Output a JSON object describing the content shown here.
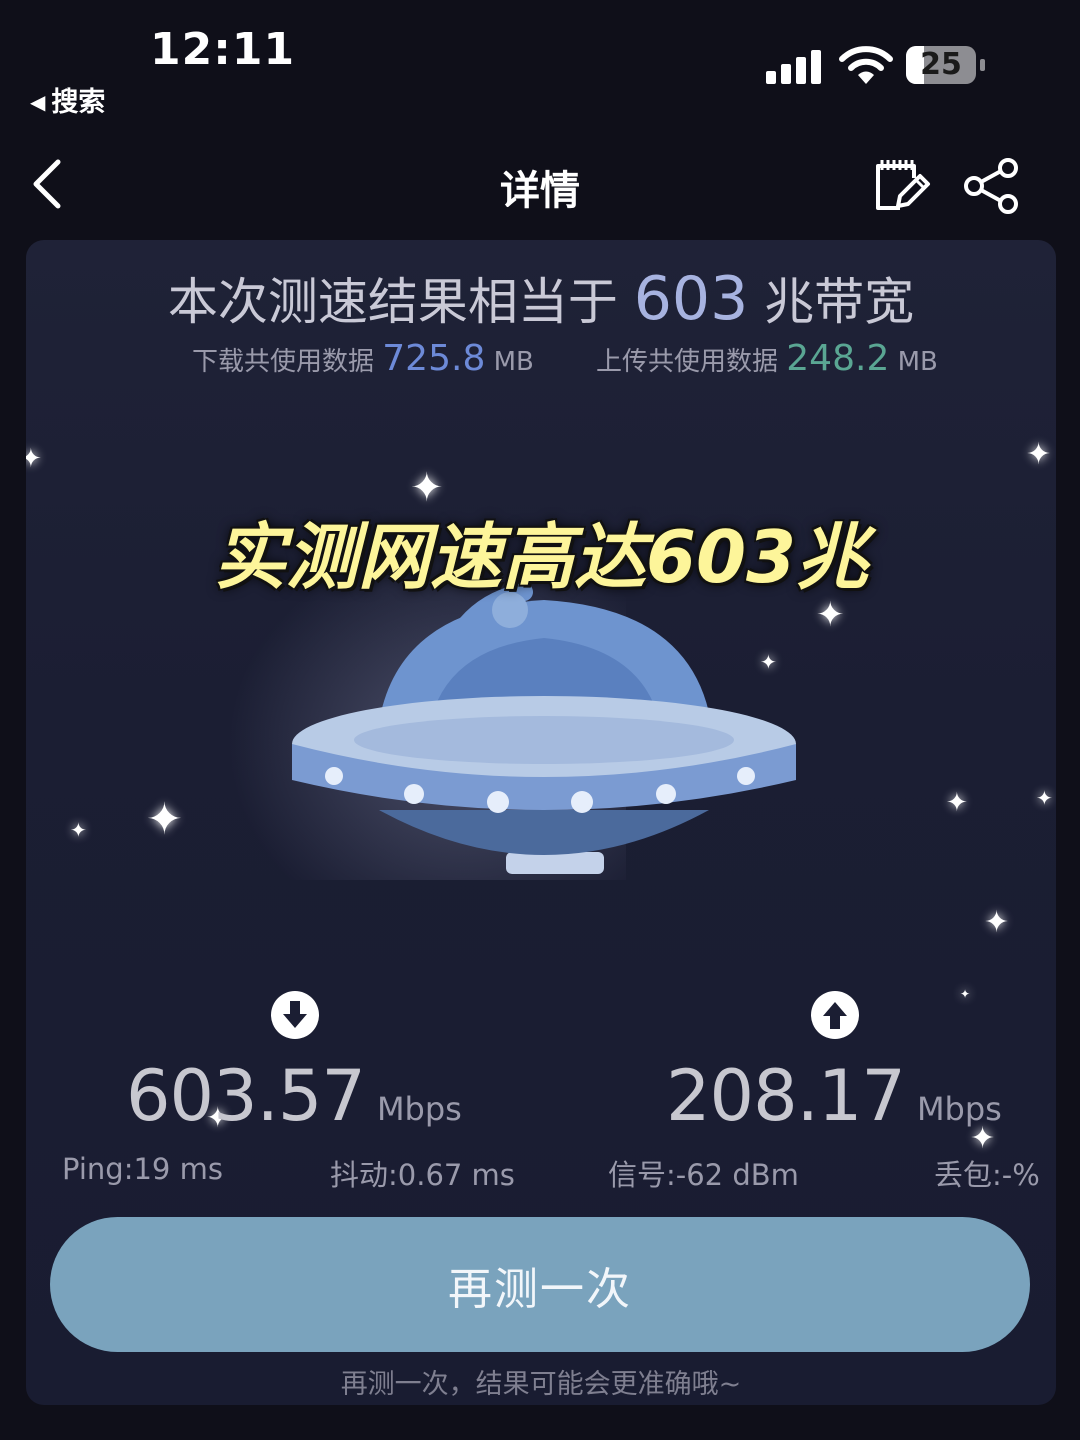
{
  "status_bar": {
    "time": "12:11",
    "back_app_label": "搜索",
    "battery_level": "25"
  },
  "nav": {
    "title": "详情",
    "icons": {
      "back": "chevron-left-icon",
      "edit": "edit-note-icon",
      "share": "share-icon"
    }
  },
  "result": {
    "summary_prefix": "本次测速结果相当于",
    "bandwidth": "603",
    "summary_suffix": "兆带宽",
    "download_usage_label": "下载共使用数据",
    "download_usage_value": "725.8",
    "download_usage_unit": "MB",
    "upload_usage_label": "上传共使用数据",
    "upload_usage_value": "248.2",
    "upload_usage_unit": "MB"
  },
  "overlay_caption": "实测网速高达603兆",
  "speeds": {
    "download": {
      "value": "603.57",
      "unit": "Mbps",
      "icon": "download-arrow-icon"
    },
    "upload": {
      "value": "208.17",
      "unit": "Mbps",
      "icon": "upload-arrow-icon"
    }
  },
  "metrics": {
    "ping": "Ping:19 ms",
    "jitter": "抖动:0.67 ms",
    "signal": "信号:-62 dBm",
    "packet_loss": "丢包:-%"
  },
  "retest_button": "再测一次",
  "hint": "再测一次，结果可能会更准确哦~",
  "colors": {
    "background": "#0f0f19",
    "card": "#1e2135",
    "accent_blue": "#6d8ad8",
    "accent_green": "#5aa693",
    "button": "#7aa3bd",
    "caption": "#fdf59a"
  }
}
